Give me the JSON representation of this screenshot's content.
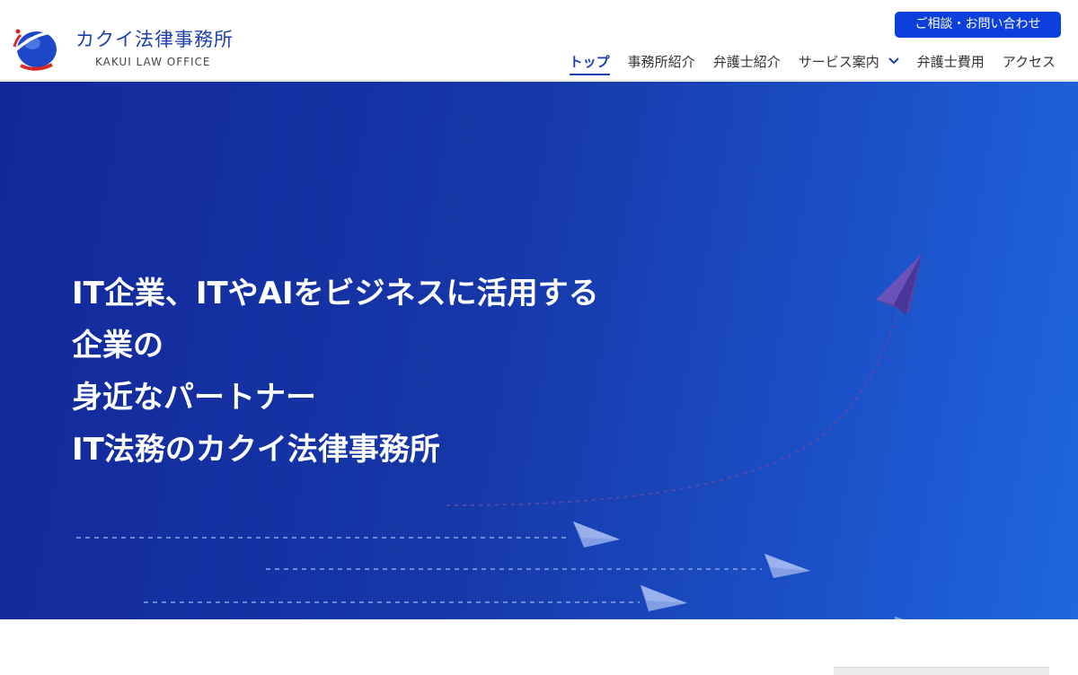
{
  "header": {
    "brand_jp": "カクイ法律事務所",
    "brand_en": "KAKUI LAW OFFICE",
    "contact_button": "ご相談・お問い合わせ",
    "nav": [
      {
        "label": "トップ",
        "active": true
      },
      {
        "label": "事務所紹介",
        "active": false
      },
      {
        "label": "弁護士紹介",
        "active": false
      },
      {
        "label": "サービス案内",
        "active": false,
        "has_dropdown": true
      },
      {
        "label": "弁護士費用",
        "active": false
      },
      {
        "label": "アクセス",
        "active": false
      }
    ]
  },
  "hero": {
    "lines": [
      "IT企業、ITやAIをビジネスに活用する",
      "企業の",
      "身近なパートナー",
      "IT法務のカクイ法律事務所"
    ]
  },
  "colors": {
    "brand_blue": "#1d3fae",
    "button_blue": "#0d3fdd",
    "hero_gradient_start": "#12289a",
    "hero_gradient_end": "#1f66df"
  },
  "icons": {
    "logo": "globe-swoosh-logo",
    "dropdown": "chevron-down-icon",
    "decoration": "paper-plane-icon"
  }
}
